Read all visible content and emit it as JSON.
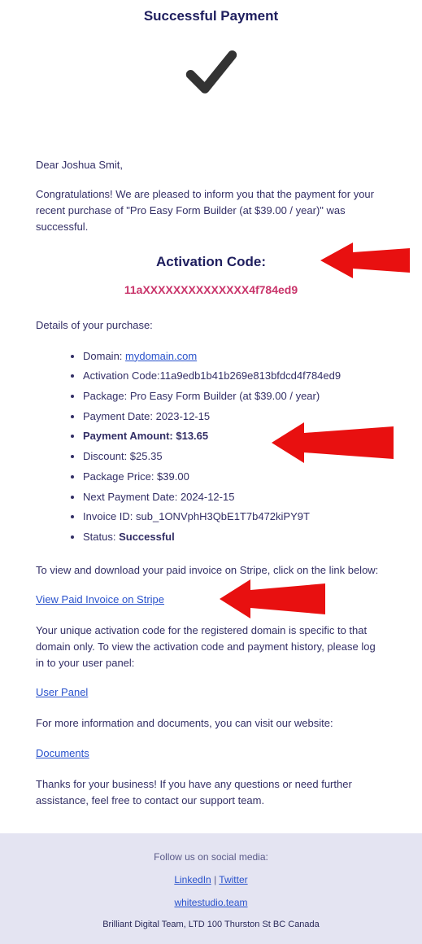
{
  "title": "Successful Payment",
  "greeting": "Dear Joshua Smit,",
  "intro": "Congratulations! We are pleased to inform you that the payment for your recent purchase of \"Pro Easy Form Builder (at $39.00 / year)\" was successful.",
  "activation_heading": "Activation Code:",
  "activation_code_masked": "11aXXXXXXXXXXXXXX4f784ed9",
  "details_label": "Details of your purchase:",
  "details": {
    "domain_label": "Domain: ",
    "domain_value": "mydomain.com",
    "activation_code_line": "Activation Code:11a9edb1b41b269e813bfdcd4f784ed9",
    "package_line": "Package: Pro Easy Form Builder (at $39.00 / year)",
    "payment_date_line": "Payment Date: 2023-12-15",
    "payment_amount_line": "Payment Amount: $13.65",
    "discount_line": "Discount: $25.35",
    "package_price_line": "Package Price: $39.00",
    "next_payment_line": "Next Payment Date: 2024-12-15",
    "invoice_id_line": "Invoice ID: sub_1ONVphH3QbE1T7b472kiPY9T",
    "status_prefix": "Status: ",
    "status_value": "Successful"
  },
  "invoice_text": "To view and download your paid invoice on Stripe, click on the link below:",
  "invoice_link": "View Paid Invoice on Stripe",
  "note_text": "Your unique activation code for the registered domain is specific to that domain only. To view the activation code and payment history, please log in to your user panel:",
  "user_panel_link": "User Panel",
  "docs_text": "For more information and documents, you can visit our website:",
  "documents_link": "Documents",
  "thanks_text": "Thanks for your business! If you have any questions or need further assistance, feel free to contact our support team.",
  "footer": {
    "follow": "Follow us on social media:",
    "linkedin": "LinkedIn",
    "twitter": "Twitter",
    "site": "whitestudio.team",
    "company": "Brilliant Digital Team, LTD 100 Thurston St BC Canada"
  }
}
